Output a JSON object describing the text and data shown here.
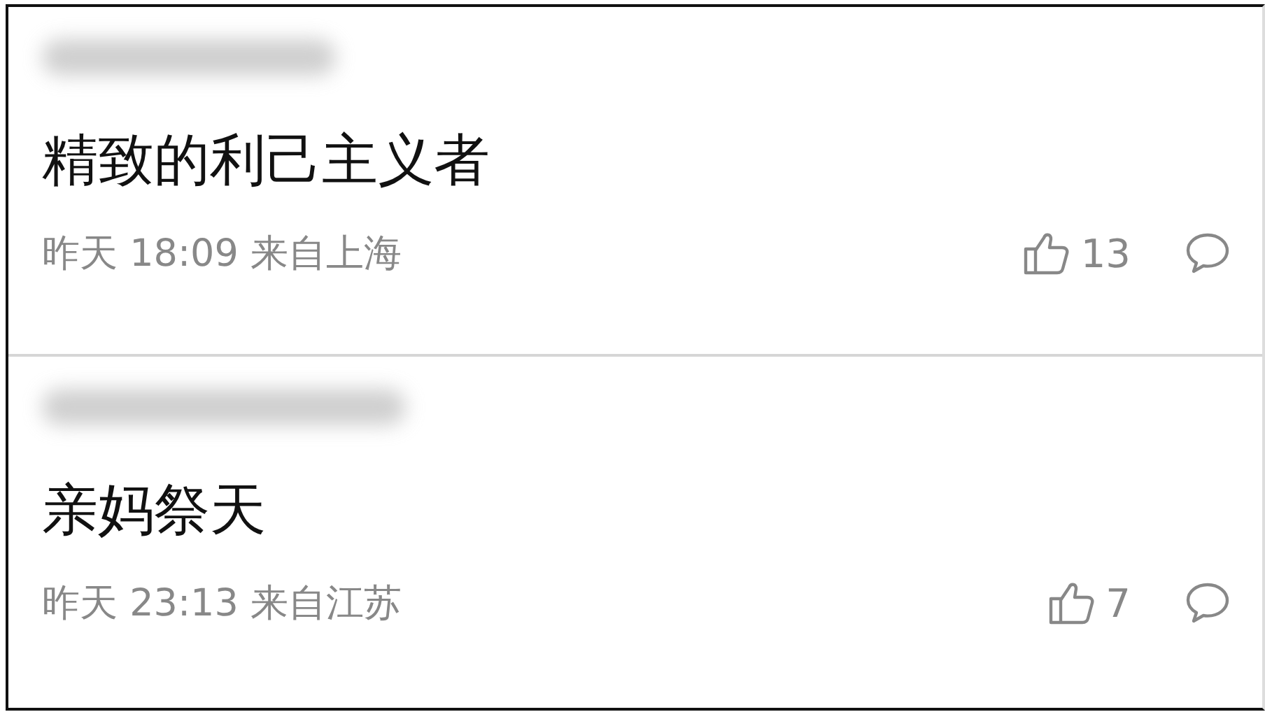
{
  "comments": [
    {
      "text": "精致的利己主义者",
      "time": "昨天 18:09",
      "location": "来自上海",
      "likes": "13"
    },
    {
      "text": "亲妈祭天",
      "time": "昨天 23:13",
      "location": "来自江苏",
      "likes": "7"
    }
  ]
}
